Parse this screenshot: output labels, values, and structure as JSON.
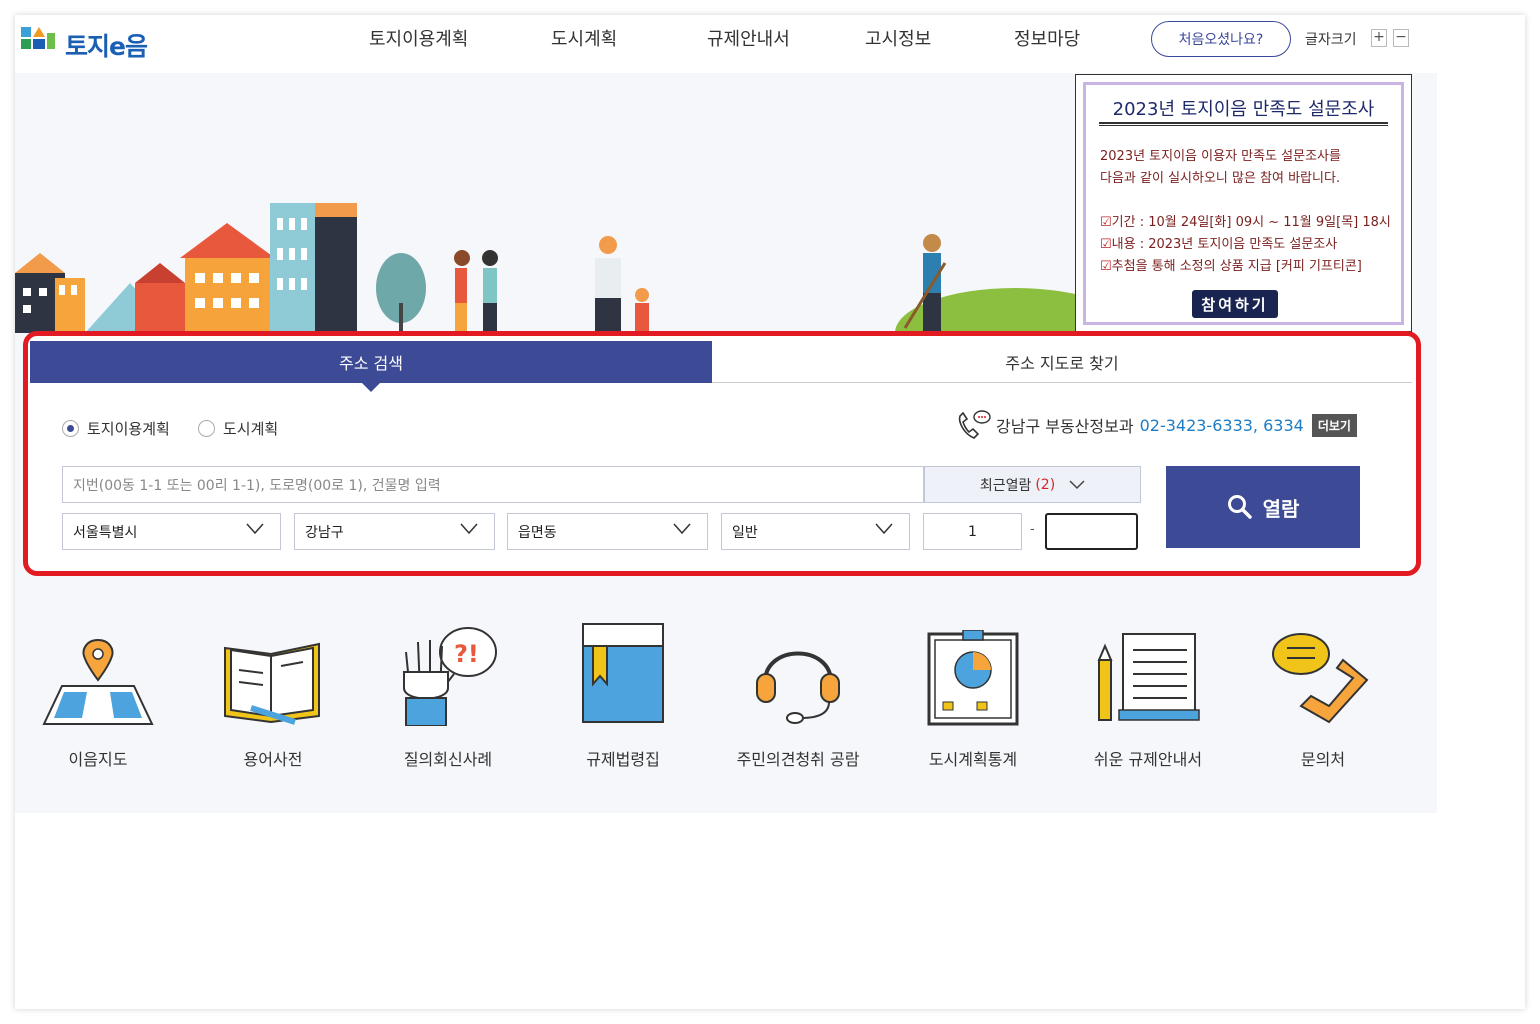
{
  "header": {
    "logo_text": "토지e음",
    "nav": [
      "토지이용계획",
      "도시계획",
      "규제안내서",
      "고시정보",
      "정보마당"
    ],
    "first_visit": "처음오셨나요?",
    "font_size_label": "글자크기",
    "font_plus": "+",
    "font_minus": "−"
  },
  "popup": {
    "title": "2023년 토지이음 만족도 설문조사",
    "intro1": "2023년 토지이음 이용자 만족도 설문조사를",
    "intro2": "다음과 같이 실시하오니 많은 참여 바랍니다.",
    "period": "기간 : 10월 24일[화] 09시 ~ 11월 9일[목] 18시",
    "content": "내용 : 2023년 토지이음 만족도 설문조사",
    "reward": "추첨을 통해 소정의 상품 지급 [커피 기프티콘]",
    "join_button": "참여하기"
  },
  "search": {
    "tabs": [
      "주소 검색",
      "주소 지도로 찾기"
    ],
    "radio_options": [
      "토지이용계획",
      "도시계획"
    ],
    "selected_radio": "토지이용계획",
    "contact_text": "강남구 부동산정보과",
    "contact_phone": "02-3423-6333, 6334",
    "more_button": "더보기",
    "address_placeholder": "지번(00동 1-1 또는 00리 1-1), 도로명(00로 1), 건물명 입력",
    "recent_label": "최근열람",
    "recent_count": "(2)",
    "select_city": "서울특별시",
    "select_district": "강남구",
    "select_dong": "읍면동",
    "select_type": "일반",
    "main_number": "1",
    "dash": "-",
    "sub_number": "",
    "view_button": "열람"
  },
  "quick_links": [
    "이음지도",
    "용어사전",
    "질의회신사례",
    "규제법령집",
    "주민의견청취 공람",
    "도시계획통계",
    "쉬운 규제안내서",
    "문의처"
  ],
  "colors": {
    "primary": "#3d4a96",
    "highlight": "#e21b23",
    "phone": "#1e7cc4"
  }
}
